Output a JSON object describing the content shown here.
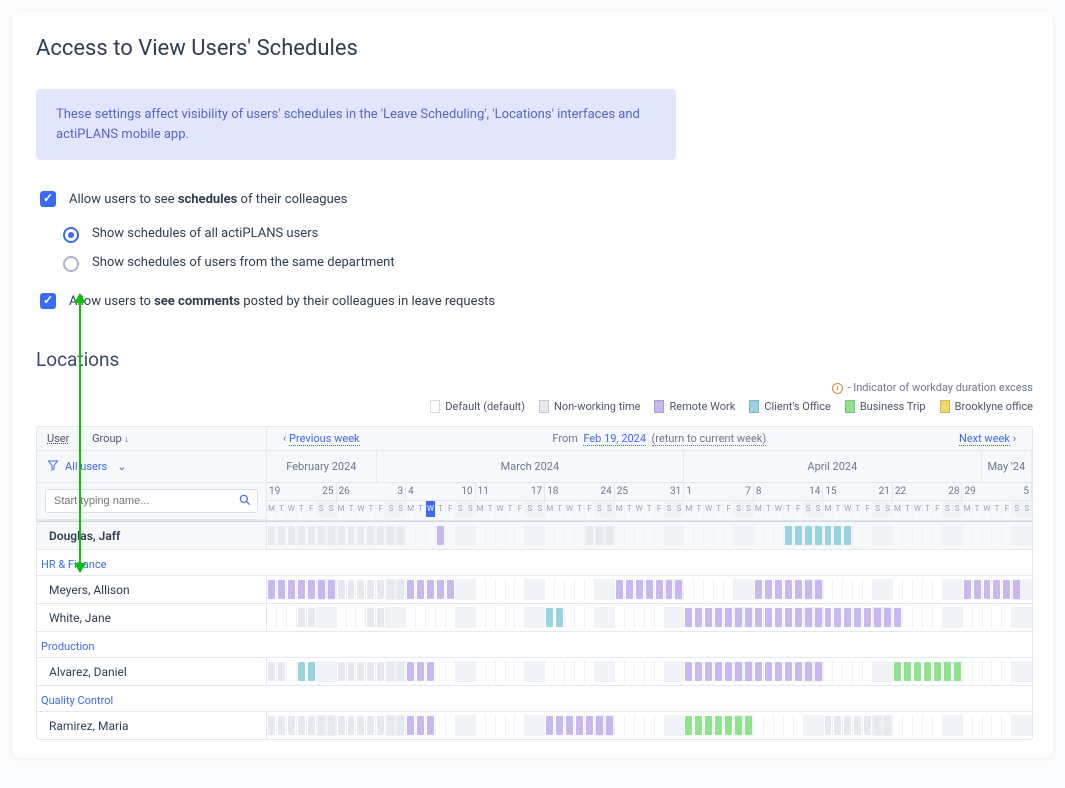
{
  "title": "Access to View Users' Schedules",
  "info": "These settings affect visibility of users' schedules in the 'Leave Scheduling', 'Locations' interfaces and actiPLANS mobile app.",
  "settings": {
    "allow_schedules_pre": "Allow users to see ",
    "allow_schedules_bold": "schedules",
    "allow_schedules_post": " of their colleagues",
    "opt_all": "Show schedules of all actiPLANS users",
    "opt_dept": "Show schedules of users from the same department",
    "allow_comments_pre": "Allow users to ",
    "allow_comments_bold": "see comments",
    "allow_comments_post": " posted by their colleagues in leave requests"
  },
  "locations_heading": "Locations",
  "excess_text": "- Indicator of workday duration excess",
  "legend": [
    {
      "label": "Default (default)",
      "color": "#ffffff"
    },
    {
      "label": "Non-working time",
      "color": "#e6eaf0"
    },
    {
      "label": "Remote Work",
      "color": "#c9b8f0"
    },
    {
      "label": "Client's Office",
      "color": "#9ad3e0"
    },
    {
      "label": "Business Trip",
      "color": "#91e28f"
    },
    {
      "label": "Brooklyne office",
      "color": "#f2d96b"
    }
  ],
  "colors": {
    "nonworking": "#e6eaf0",
    "remote": "#c9b8f0",
    "client": "#9ad3e0",
    "business": "#91e28f",
    "brooklyne": "#f2d96b"
  },
  "nav": {
    "prev": "Previous week",
    "next": "Next week",
    "from_label": "From",
    "from_date": "Feb 19, 2024",
    "return": "(return to current week)"
  },
  "left_header": {
    "user": "User",
    "group": "Group",
    "filter": "All users",
    "search_placeholder": "Start typing name..."
  },
  "months": [
    {
      "label": "February 2024",
      "days": 11
    },
    {
      "label": "March 2024",
      "days": 31
    },
    {
      "label": "April 2024",
      "days": 30
    },
    {
      "label": "May '24",
      "days": 5
    }
  ],
  "weeks": [
    {
      "start": "19",
      "end": "25",
      "days": 7
    },
    {
      "start": "26",
      "end": "3",
      "days": 7
    },
    {
      "start": "4",
      "end": "10",
      "days": 7
    },
    {
      "start": "11",
      "end": "17",
      "days": 7
    },
    {
      "start": "18",
      "end": "24",
      "days": 7
    },
    {
      "start": "25",
      "end": "31",
      "days": 7
    },
    {
      "start": "1",
      "end": "7",
      "days": 7
    },
    {
      "start": "8",
      "end": "14",
      "days": 7
    },
    {
      "start": "15",
      "end": "21",
      "days": 7
    },
    {
      "start": "22",
      "end": "28",
      "days": 7
    },
    {
      "start": "29",
      "end": "5",
      "days": 7
    }
  ],
  "day_letters": [
    "M",
    "T",
    "W",
    "T",
    "F",
    "S",
    "S"
  ],
  "today_index": 16,
  "rows": [
    {
      "type": "user",
      "name": "Douglas, Jaff",
      "highlight": true,
      "fills": {
        "0-13": "nonworking",
        "17": "remote",
        "52-57": "client",
        "32-34": "nonworking",
        "53-55": "client",
        "56-58": "client"
      }
    },
    {
      "type": "group",
      "name": "HR & Finance"
    },
    {
      "type": "user",
      "name": "Meyers, Allison",
      "fills": {
        "0-6": "remote",
        "7-13": "nonworking",
        "14-18": "remote",
        "35-41": "remote",
        "49-55": "remote",
        "70-75": "remote"
      }
    },
    {
      "type": "user",
      "name": "White, Jane",
      "fills": {
        "3-4": "nonworking",
        "10-11": "nonworking",
        "28-29": "client",
        "42-55": "remote",
        "56-63": "remote"
      }
    },
    {
      "type": "group",
      "name": "Production"
    },
    {
      "type": "user",
      "name": "Alvarez, Daniel",
      "fills": {
        "0-1": "nonworking",
        "3-4": "client",
        "7-13": "nonworking",
        "14-16": "remote",
        "42-48": "remote",
        "49-55": "remote",
        "63-69": "business"
      }
    },
    {
      "type": "group",
      "name": "Quality Control"
    },
    {
      "type": "user",
      "name": "Ramirez, Maria",
      "fills": {
        "0-6": "nonworking",
        "7-13": "nonworking",
        "14-16": "remote",
        "28-34": "remote",
        "42-48": "business",
        "56-62": "nonworking"
      }
    }
  ]
}
